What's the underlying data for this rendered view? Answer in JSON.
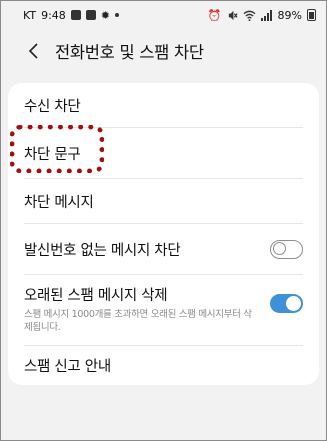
{
  "status_bar": {
    "carrier": "KT",
    "time": "9:48",
    "battery": "89%"
  },
  "header": {
    "title": "전화번호 및 스팸 차단"
  },
  "settings": {
    "items": [
      {
        "label": "수신 차단"
      },
      {
        "label": "차단 문구"
      },
      {
        "label": "차단 메시지"
      },
      {
        "label": "발신번호 없는 메시지 차단",
        "toggle": "off"
      },
      {
        "label": "오래된 스팸 메시지 삭제",
        "description": "스팸 메시지 1000개를 초과하면 오래된 스팸 메시지부터 삭제됩니다.",
        "toggle": "on"
      },
      {
        "label": "스팸 신고 안내"
      }
    ]
  },
  "colors": {
    "accent": "#3e91d8",
    "highlight": "#a40e0e",
    "background": "#f2f2f2"
  },
  "icons": [
    "back-arrow-icon",
    "alarm-icon",
    "mute-icon",
    "wifi-icon",
    "signal-icon",
    "battery-icon"
  ]
}
